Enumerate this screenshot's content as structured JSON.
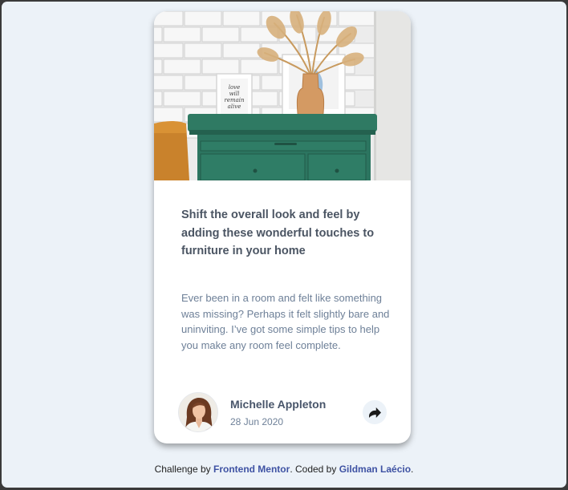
{
  "article": {
    "title": "Shift the overall look and feel by adding these wonderful touches to furniture in your home",
    "description": "Ever been in a room and felt like something was missing? Perhaps it felt slightly bare and uninviting. I’ve got some simple tips to help you make any room feel complete.",
    "image_alt": "drawers"
  },
  "author": {
    "name": "Michelle Appleton",
    "date": "28 Jun 2020"
  },
  "share": {
    "icon": "share-arrow-icon"
  },
  "attribution": {
    "prefix": "Challenge by ",
    "link1": "Frontend Mentor",
    "middle": ". Coded by ",
    "link2": "Gildman Laécio",
    "suffix": "."
  },
  "frame_text": {
    "line1": "love",
    "line2": "will",
    "line3": "remain",
    "line4": "alive"
  },
  "colors": {
    "page_bg": "#ecf2f8",
    "card_bg": "#ffffff",
    "title": "#4b5563",
    "body_text": "#6e8098",
    "link": "#3e52a3"
  }
}
